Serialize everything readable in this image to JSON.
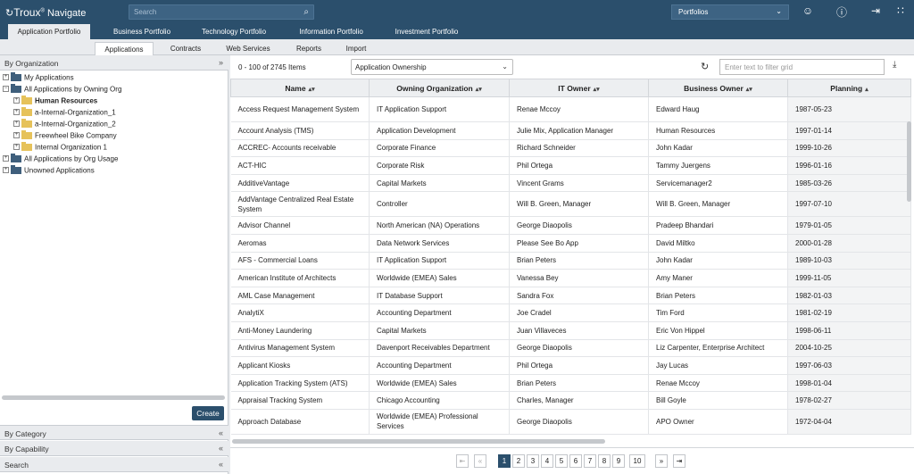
{
  "app": {
    "brand": "Troux",
    "product": "Navigate",
    "search_placeholder": "Search",
    "portfolio_select": "Portfolios"
  },
  "portfolio_tabs": [
    "Application Portfolio",
    "Business Portfolio",
    "Technology Portfolio",
    "Information Portfolio",
    "Investment Portfolio"
  ],
  "sub_tabs": [
    "Applications",
    "Contracts",
    "Web Services",
    "Reports",
    "Import"
  ],
  "sidebar": {
    "header": "By Organization",
    "tree": [
      {
        "label": "My Applications",
        "icon": "folder-dark"
      },
      {
        "label": "All Applications by Owning Org",
        "icon": "folder-dark"
      },
      {
        "label": "Human Resources",
        "icon": "folder-yellow"
      },
      {
        "label": "a-Internal-Organization_1",
        "icon": "folder-yellow"
      },
      {
        "label": "a-Internal-Organization_2",
        "icon": "folder-yellow"
      },
      {
        "label": "Freewheel Bike Company",
        "icon": "folder-yellow"
      },
      {
        "label": "Internal Organization 1",
        "icon": "folder-yellow"
      },
      {
        "label": "All Applications by Org Usage",
        "icon": "folder-dark"
      },
      {
        "label": "Unowned Applications",
        "icon": "folder-dark"
      }
    ],
    "create_label": "Create",
    "sections": [
      "By Category",
      "By Capability",
      "Search"
    ]
  },
  "grid": {
    "count_label": "0 - 100 of 2745 Items",
    "view_select": "Application Ownership",
    "filter_placeholder": "Enter text to filter grid",
    "columns": [
      "Name",
      "Owning Organization",
      "IT Owner",
      "Business Owner",
      "Planning"
    ],
    "rows": [
      [
        "Access Request Management System",
        "IT Application Support",
        "Renae Mccoy",
        "Edward Haug",
        "1987-05-23"
      ],
      [
        "Account Analysis (TMS)",
        "Application Development",
        "Julie Mix, Application Manager",
        "Human Resources",
        "1997-01-14"
      ],
      [
        "ACCREC- Accounts receivable",
        "Corporate Finance",
        "Richard Schneider",
        "John Kadar",
        "1999-10-26"
      ],
      [
        "ACT-HIC",
        "Corporate Risk",
        "Phil Ortega",
        "Tammy Juergens",
        "1996-01-16"
      ],
      [
        "AdditiveVantage",
        "Capital Markets",
        "Vincent Grams",
        "Servicemanager2",
        "1985-03-26"
      ],
      [
        "AddVantage Centralized Real Estate System",
        "Controller",
        "Will B. Green, Manager",
        "Will B. Green, Manager",
        "1997-07-10"
      ],
      [
        "Advisor Channel",
        "North American (NA) Operations",
        "George Diaopolis",
        "Pradeep Bhandari",
        "1979-01-05"
      ],
      [
        "Aeromas",
        "Data Network Services",
        "Please See Bo App",
        "David Miltko",
        "2000-01-28"
      ],
      [
        "AFS - Commercial Loans",
        "IT Application Support",
        "Brian Peters",
        "John Kadar",
        "1989-10-03"
      ],
      [
        "American Institute of Architects",
        "Worldwide (EMEA) Sales",
        "Vanessa Bey",
        "Amy Maner",
        "1999-11-05"
      ],
      [
        "AML Case Management",
        "IT Database Support",
        "Sandra Fox",
        "Brian Peters",
        "1982-01-03"
      ],
      [
        "AnalytiX",
        "Accounting Department",
        "Joe Cradel",
        "Tim Ford",
        "1981-02-19"
      ],
      [
        "Anti-Money Laundering",
        "Capital Markets",
        "Juan Villaveces",
        "Eric Von Hippel",
        "1998-06-11"
      ],
      [
        "Antivirus Management System",
        "Davenport Receivables Department",
        "George Diaopolis",
        "Liz Carpenter, Enterprise Architect",
        "2004-10-25"
      ],
      [
        "Applicant Kiosks",
        "Accounting Department",
        "Phil Ortega",
        "Jay Lucas",
        "1997-06-03"
      ],
      [
        "Application Tracking System (ATS)",
        "Worldwide (EMEA) Sales",
        "Brian Peters",
        "Renae Mccoy",
        "1998-01-04"
      ],
      [
        "Appraisal Tracking System",
        "Chicago Accounting",
        "Charles, Manager",
        "Bill Goyle",
        "1978-02-27"
      ],
      [
        "Approach Database",
        "Worldwide (EMEA) Professional Services",
        "George Diaopolis",
        "APO Owner",
        "1972-04-04"
      ]
    ]
  },
  "pager": {
    "pages": [
      "1",
      "2",
      "3",
      "4",
      "5",
      "6",
      "7",
      "8",
      "9",
      "10"
    ],
    "current": "1"
  }
}
